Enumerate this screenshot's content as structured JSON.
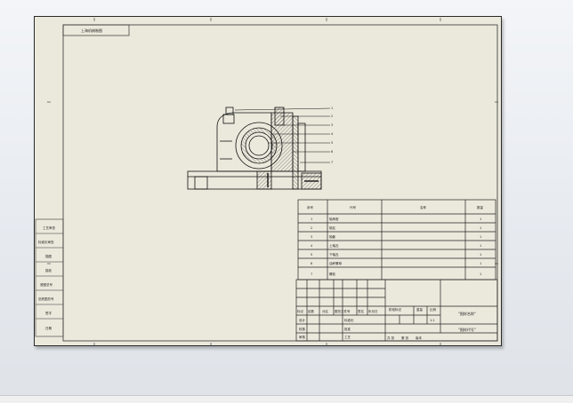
{
  "drawing": {
    "sheet_tab": "上海机械制图",
    "side_labels": [
      "工艺审查",
      "标准化审查",
      "描图",
      "描校",
      "底图总号",
      "旧底图总号",
      "签字",
      "日期"
    ],
    "bom": {
      "headers": [
        "序号",
        "代号",
        "名称",
        "数量"
      ],
      "rows": [
        {
          "no": "1",
          "code": "轴承座",
          "qty": "1"
        },
        {
          "no": "2",
          "code": "轴瓦",
          "qty": "1"
        },
        {
          "no": "3",
          "code": "轴套",
          "qty": "1"
        },
        {
          "no": "4",
          "code": "上轴瓦",
          "qty": "1"
        },
        {
          "no": "5",
          "code": "下轴瓦",
          "qty": "1"
        },
        {
          "no": "6",
          "code": "油杯螺母",
          "qty": "1"
        },
        {
          "no": "7",
          "code": "螺栓",
          "qty": "1"
        }
      ]
    },
    "title_block": {
      "rev_headers": [
        "标记",
        "处数",
        "分区",
        "更改文件号",
        "签名",
        "年月日"
      ],
      "roles": [
        "设计",
        "校核",
        "审核",
        "工艺"
      ],
      "roles_right": [
        "标准化",
        "批准"
      ],
      "stage_labels": [
        "阶段标记",
        "重量",
        "比例"
      ],
      "ratio": "1:1",
      "sheet_info": [
        "共 张",
        "第 张"
      ],
      "drawing_name": "\"图样名称\"",
      "drawing_code": "\"图样代号\"",
      "footer": [
        "共 张",
        "第 张",
        "版本"
      ]
    }
  }
}
